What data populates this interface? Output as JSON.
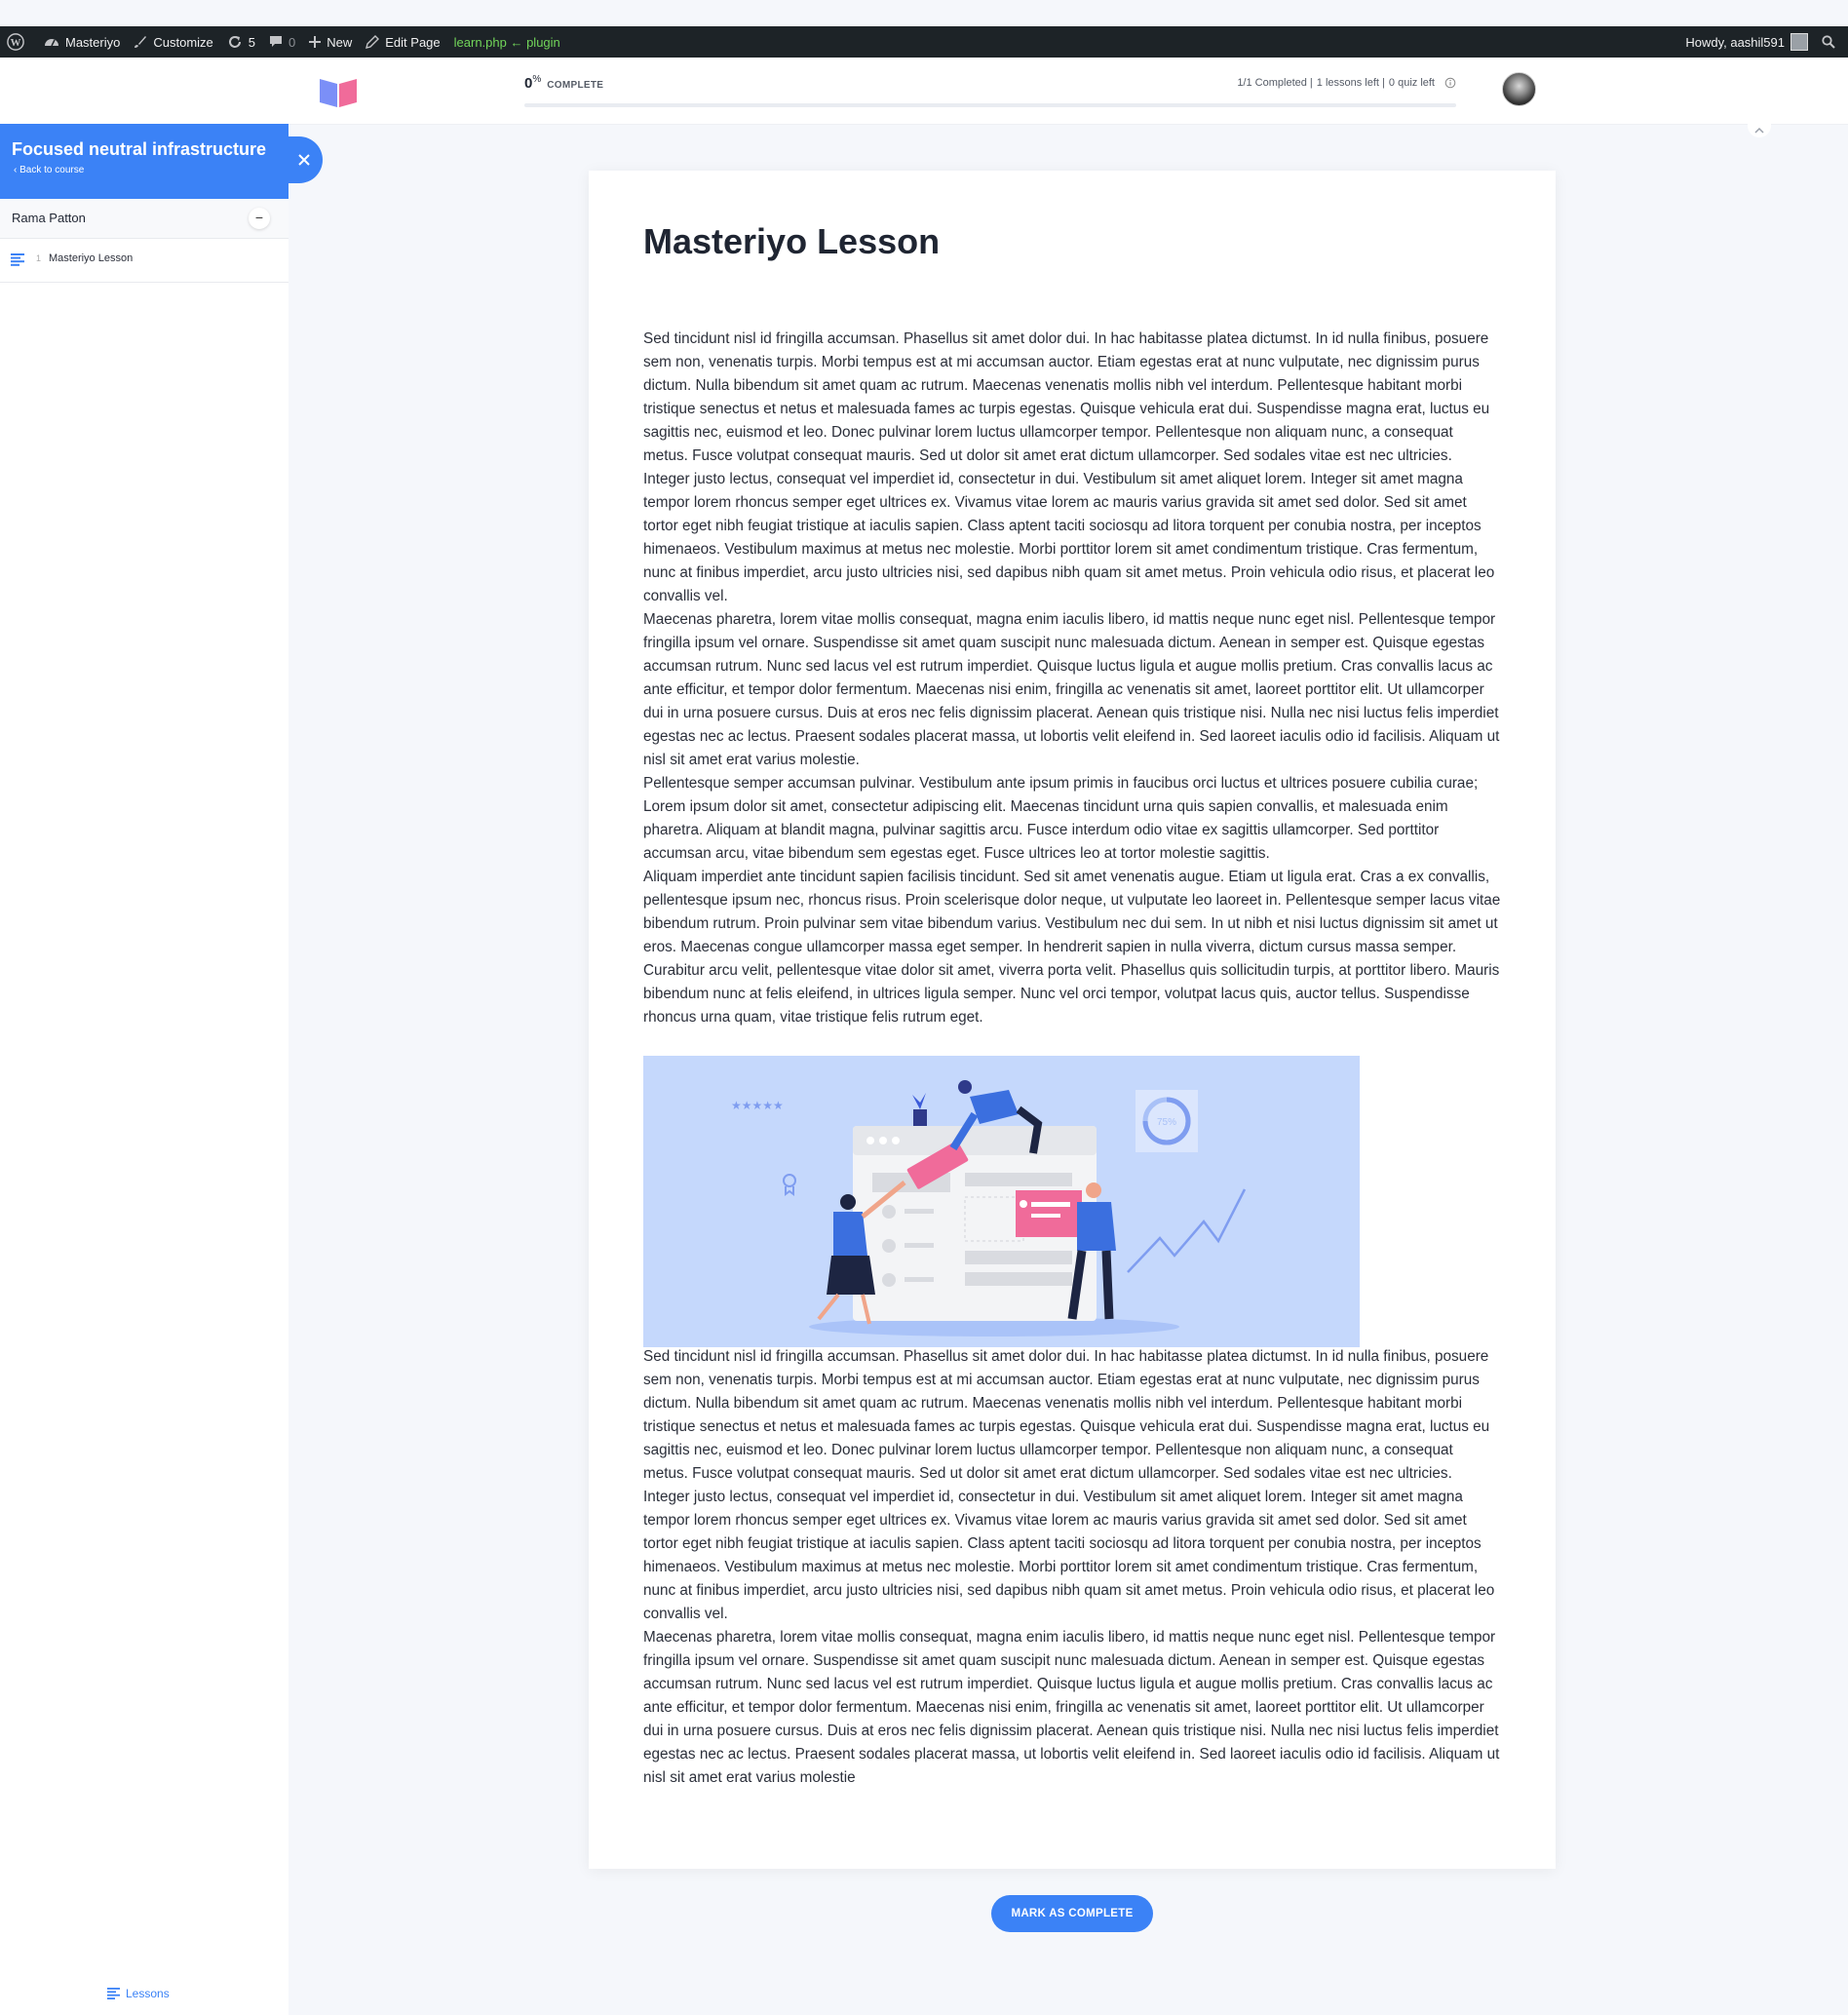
{
  "admin_bar": {
    "site_name": "Masteriyo",
    "customize": "Customize",
    "updates_count": "5",
    "comments_count": "0",
    "new_label": "New",
    "edit_page": "Edit Page",
    "debug_text": "learn.php ← plugin",
    "greeting": "Howdy, aashil591"
  },
  "header": {
    "progress_value": "0",
    "progress_unit": "%",
    "progress_label": "COMPLETE",
    "progress_fraction": 0,
    "completed": "1/1 Completed |",
    "lessons_left": "1 lessons left |",
    "quiz_left": "0 quiz left"
  },
  "sidebar": {
    "course_title": "Focused neutral infrastructure",
    "back_label": "Back to course",
    "section_title": "Rama Patton",
    "lessons": [
      {
        "number": "1",
        "title": "Masteriyo Lesson"
      }
    ],
    "footer_label": "Lessons"
  },
  "lesson": {
    "title": "Masteriyo Lesson",
    "paragraphs_top": [
      "Sed tincidunt nisl id fringilla accumsan. Phasellus sit amet dolor dui. In hac habitasse platea dictumst. In id nulla finibus, posuere sem non, venenatis turpis. Morbi tempus est at mi accumsan auctor. Etiam egestas erat at nunc vulputate, nec dignissim purus dictum. Nulla bibendum sit amet quam ac rutrum. Maecenas venenatis mollis nibh vel interdum. Pellentesque habitant morbi tristique senectus et netus et malesuada fames ac turpis egestas. Quisque vehicula erat dui. Suspendisse magna erat, luctus eu sagittis nec, euismod et leo. Donec pulvinar lorem luctus ullamcorper tempor. Pellentesque non aliquam nunc, a consequat metus. Fusce volutpat consequat mauris. Sed ut dolor sit amet erat dictum ullamcorper. Sed sodales vitae est nec ultricies.",
      "Integer justo lectus, consequat vel imperdiet id, consectetur in dui. Vestibulum sit amet aliquet lorem. Integer sit amet magna tempor lorem rhoncus semper eget ultrices ex. Vivamus vitae lorem ac mauris varius gravida sit amet sed dolor. Sed sit amet tortor eget nibh feugiat tristique at iaculis sapien. Class aptent taciti sociosqu ad litora torquent per conubia nostra, per inceptos himenaeos. Vestibulum maximus at metus nec molestie. Morbi porttitor lorem sit amet condimentum tristique. Cras fermentum, nunc at finibus imperdiet, arcu justo ultricies nisi, sed dapibus nibh quam sit amet metus. Proin vehicula odio risus, et placerat leo convallis vel.",
      "Maecenas pharetra, lorem vitae mollis consequat, magna enim iaculis libero, id mattis neque nunc eget nisl. Pellentesque tempor fringilla ipsum vel ornare. Suspendisse sit amet quam suscipit nunc malesuada dictum. Aenean in semper est. Quisque egestas accumsan rutrum. Nunc sed lacus vel est rutrum imperdiet. Quisque luctus ligula et augue mollis pretium. Cras convallis lacus ac ante efficitur, et tempor dolor fermentum. Maecenas nisi enim, fringilla ac venenatis sit amet, laoreet porttitor elit. Ut ullamcorper dui in urna posuere cursus. Duis at eros nec felis dignissim placerat. Aenean quis tristique nisi. Nulla nec nisi luctus felis imperdiet egestas nec ac lectus. Praesent sodales placerat massa, ut lobortis velit eleifend in. Sed laoreet iaculis odio id facilisis. Aliquam ut nisl sit amet erat varius molestie.",
      "Pellentesque semper accumsan pulvinar. Vestibulum ante ipsum primis in faucibus orci luctus et ultrices posuere cubilia curae; Lorem ipsum dolor sit amet, consectetur adipiscing elit. Maecenas tincidunt urna quis sapien convallis, et malesuada enim pharetra. Aliquam at blandit magna, pulvinar sagittis arcu. Fusce interdum odio vitae ex sagittis ullamcorper. Sed porttitor accumsan arcu, vitae bibendum sem egestas eget. Fusce ultrices leo at tortor molestie sagittis.",
      "Aliquam imperdiet ante tincidunt sapien facilisis tincidunt. Sed sit amet venenatis augue. Etiam ut ligula erat. Cras a ex convallis, pellentesque ipsum nec, rhoncus risus. Proin scelerisque dolor neque, ut vulputate leo laoreet in. Pellentesque semper lacus vitae bibendum rutrum. Proin pulvinar sem vitae bibendum varius. Vestibulum nec dui sem. In ut nibh et nisi luctus dignissim sit amet ut eros. Maecenas congue ullamcorper massa eget semper. In hendrerit sapien in nulla viverra, dictum cursus massa semper. Curabitur arcu velit, pellentesque vitae dolor sit amet, viverra porta velit. Phasellus quis sollicitudin turpis, at porttitor libero. Mauris bibendum nunc at felis eleifend, in ultrices ligula semper. Nunc vel orci tempor, volutpat lacus quis, auctor tellus. Suspendisse rhoncus urna quam, vitae tristique felis rutrum eget."
    ],
    "illustration_badge": "75%",
    "paragraphs_bottom": [
      "Sed tincidunt nisl id fringilla accumsan. Phasellus sit amet dolor dui. In hac habitasse platea dictumst. In id nulla finibus, posuere sem non, venenatis turpis. Morbi tempus est at mi accumsan auctor. Etiam egestas erat at nunc vulputate, nec dignissim purus dictum. Nulla bibendum sit amet quam ac rutrum. Maecenas venenatis mollis nibh vel interdum. Pellentesque habitant morbi tristique senectus et netus et malesuada fames ac turpis egestas. Quisque vehicula erat dui. Suspendisse magna erat, luctus eu sagittis nec, euismod et leo. Donec pulvinar lorem luctus ullamcorper tempor. Pellentesque non aliquam nunc, a consequat metus. Fusce volutpat consequat mauris. Sed ut dolor sit amet erat dictum ullamcorper. Sed sodales vitae est nec ultricies.",
      "Integer justo lectus, consequat vel imperdiet id, consectetur in dui. Vestibulum sit amet aliquet lorem. Integer sit amet magna tempor lorem rhoncus semper eget ultrices ex. Vivamus vitae lorem ac mauris varius gravida sit amet sed dolor. Sed sit amet tortor eget nibh feugiat tristique at iaculis sapien. Class aptent taciti sociosqu ad litora torquent per conubia nostra, per inceptos himenaeos. Vestibulum maximus at metus nec molestie. Morbi porttitor lorem sit amet condimentum tristique. Cras fermentum, nunc at finibus imperdiet, arcu justo ultricies nisi, sed dapibus nibh quam sit amet metus. Proin vehicula odio risus, et placerat leo convallis vel.",
      "Maecenas pharetra, lorem vitae mollis consequat, magna enim iaculis libero, id mattis neque nunc eget nisl. Pellentesque tempor fringilla ipsum vel ornare. Suspendisse sit amet quam suscipit nunc malesuada dictum. Aenean in semper est. Quisque egestas accumsan rutrum. Nunc sed lacus vel est rutrum imperdiet. Quisque luctus ligula et augue mollis pretium. Cras convallis lacus ac ante efficitur, et tempor dolor fermentum. Maecenas nisi enim, fringilla ac venenatis sit amet, laoreet porttitor elit. Ut ullamcorper dui in urna posuere cursus. Duis at eros nec felis dignissim placerat. Aenean quis tristique nisi. Nulla nec nisi luctus felis imperdiet egestas nec ac lectus. Praesent sodales placerat massa, ut lobortis velit eleifend in. Sed laoreet iaculis odio id facilisis. Aliquam ut nisl sit amet erat varius molestie"
    ]
  },
  "footer": {
    "mark_complete": "MARK AS COMPLETE"
  },
  "colors": {
    "accent": "#3b82f6",
    "admin_bar": "#1d2327",
    "debug_green": "#72d65a",
    "illustration_bg": "#c5d8fc"
  }
}
